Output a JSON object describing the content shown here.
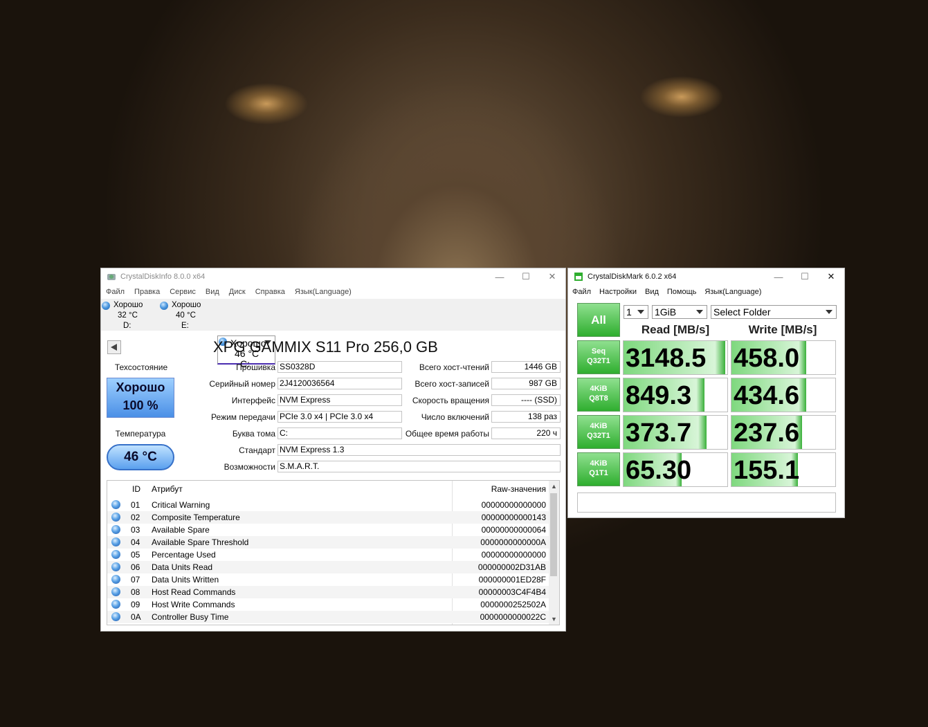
{
  "cdi": {
    "title": "CrystalDiskInfo 8.0.0 x64",
    "menu": [
      "Файл",
      "Правка",
      "Сервис",
      "Вид",
      "Диск",
      "Справка",
      "Язык(Language)"
    ],
    "drives": [
      {
        "status": "Хорошо",
        "temp": "32 °C",
        "letter": "D:"
      },
      {
        "status": "Хорошо",
        "temp": "40 °C",
        "letter": "E:"
      },
      {
        "status": "Хорошо",
        "temp": "46 °C",
        "letter": "C:"
      }
    ],
    "model": "XPG GAMMIX S11 Pro 256,0 GB",
    "health_label": "Техсостояние",
    "health_status": "Хорошо",
    "health_percent": "100 %",
    "temp_label": "Температура",
    "temp_value": "46 °C",
    "left_fields": [
      {
        "label": "Прошивка",
        "value": "SS0328D"
      },
      {
        "label": "Серийный номер",
        "value": "2J4120036564"
      },
      {
        "label": "Интерфейс",
        "value": "NVM Express"
      },
      {
        "label": "Режим передачи",
        "value": "PCIe 3.0 x4 | PCIe 3.0 x4"
      },
      {
        "label": "Буква тома",
        "value": "C:"
      },
      {
        "label": "Стандарт",
        "value": "NVM Express 1.3"
      },
      {
        "label": "Возможности",
        "value": "S.M.A.R.T."
      }
    ],
    "right_fields": [
      {
        "label": "Всего хост-чтений",
        "value": "1446 GB"
      },
      {
        "label": "Всего хост-записей",
        "value": "987 GB"
      },
      {
        "label": "Скорость вращения",
        "value": "---- (SSD)"
      },
      {
        "label": "Число включений",
        "value": "138 раз"
      },
      {
        "label": "Общее время работы",
        "value": "220 ч"
      }
    ],
    "smart_headers": {
      "id": "ID",
      "attr": "Атрибут",
      "raw": "Raw-значения"
    },
    "smart_rows": [
      {
        "id": "01",
        "name": "Critical Warning",
        "raw": "00000000000000"
      },
      {
        "id": "02",
        "name": "Composite Temperature",
        "raw": "00000000000143"
      },
      {
        "id": "03",
        "name": "Available Spare",
        "raw": "00000000000064"
      },
      {
        "id": "04",
        "name": "Available Spare Threshold",
        "raw": "0000000000000A"
      },
      {
        "id": "05",
        "name": "Percentage Used",
        "raw": "00000000000000"
      },
      {
        "id": "06",
        "name": "Data Units Read",
        "raw": "000000002D31AB"
      },
      {
        "id": "07",
        "name": "Data Units Written",
        "raw": "000000001ED28F"
      },
      {
        "id": "08",
        "name": "Host Read Commands",
        "raw": "00000003C4F4B4"
      },
      {
        "id": "09",
        "name": "Host Write Commands",
        "raw": "0000000252502A"
      },
      {
        "id": "0A",
        "name": "Controller Busy Time",
        "raw": "0000000000022C"
      }
    ]
  },
  "cdm": {
    "title": "CrystalDiskMark 6.0.2 x64",
    "menu": [
      "Файл",
      "Настройки",
      "Вид",
      "Помощь",
      "Язык(Language)"
    ],
    "all_label": "All",
    "count": "1",
    "size": "1GiB",
    "folder": "Select Folder",
    "read_header": "Read [MB/s]",
    "write_header": "Write [MB/s]",
    "tests": [
      {
        "line1": "Seq",
        "line2": "Q32T1",
        "read": "3148.5",
        "write": "458.0",
        "read_fill": 0.98,
        "write_fill": 0.72
      },
      {
        "line1": "4KiB",
        "line2": "Q8T8",
        "read": "849.3",
        "write": "434.6",
        "read_fill": 0.78,
        "write_fill": 0.72
      },
      {
        "line1": "4KiB",
        "line2": "Q32T1",
        "read": "373.7",
        "write": "237.6",
        "read_fill": 0.8,
        "write_fill": 0.68
      },
      {
        "line1": "4KiB",
        "line2": "Q1T1",
        "read": "65.30",
        "write": "155.1",
        "read_fill": 0.56,
        "write_fill": 0.64
      }
    ]
  }
}
